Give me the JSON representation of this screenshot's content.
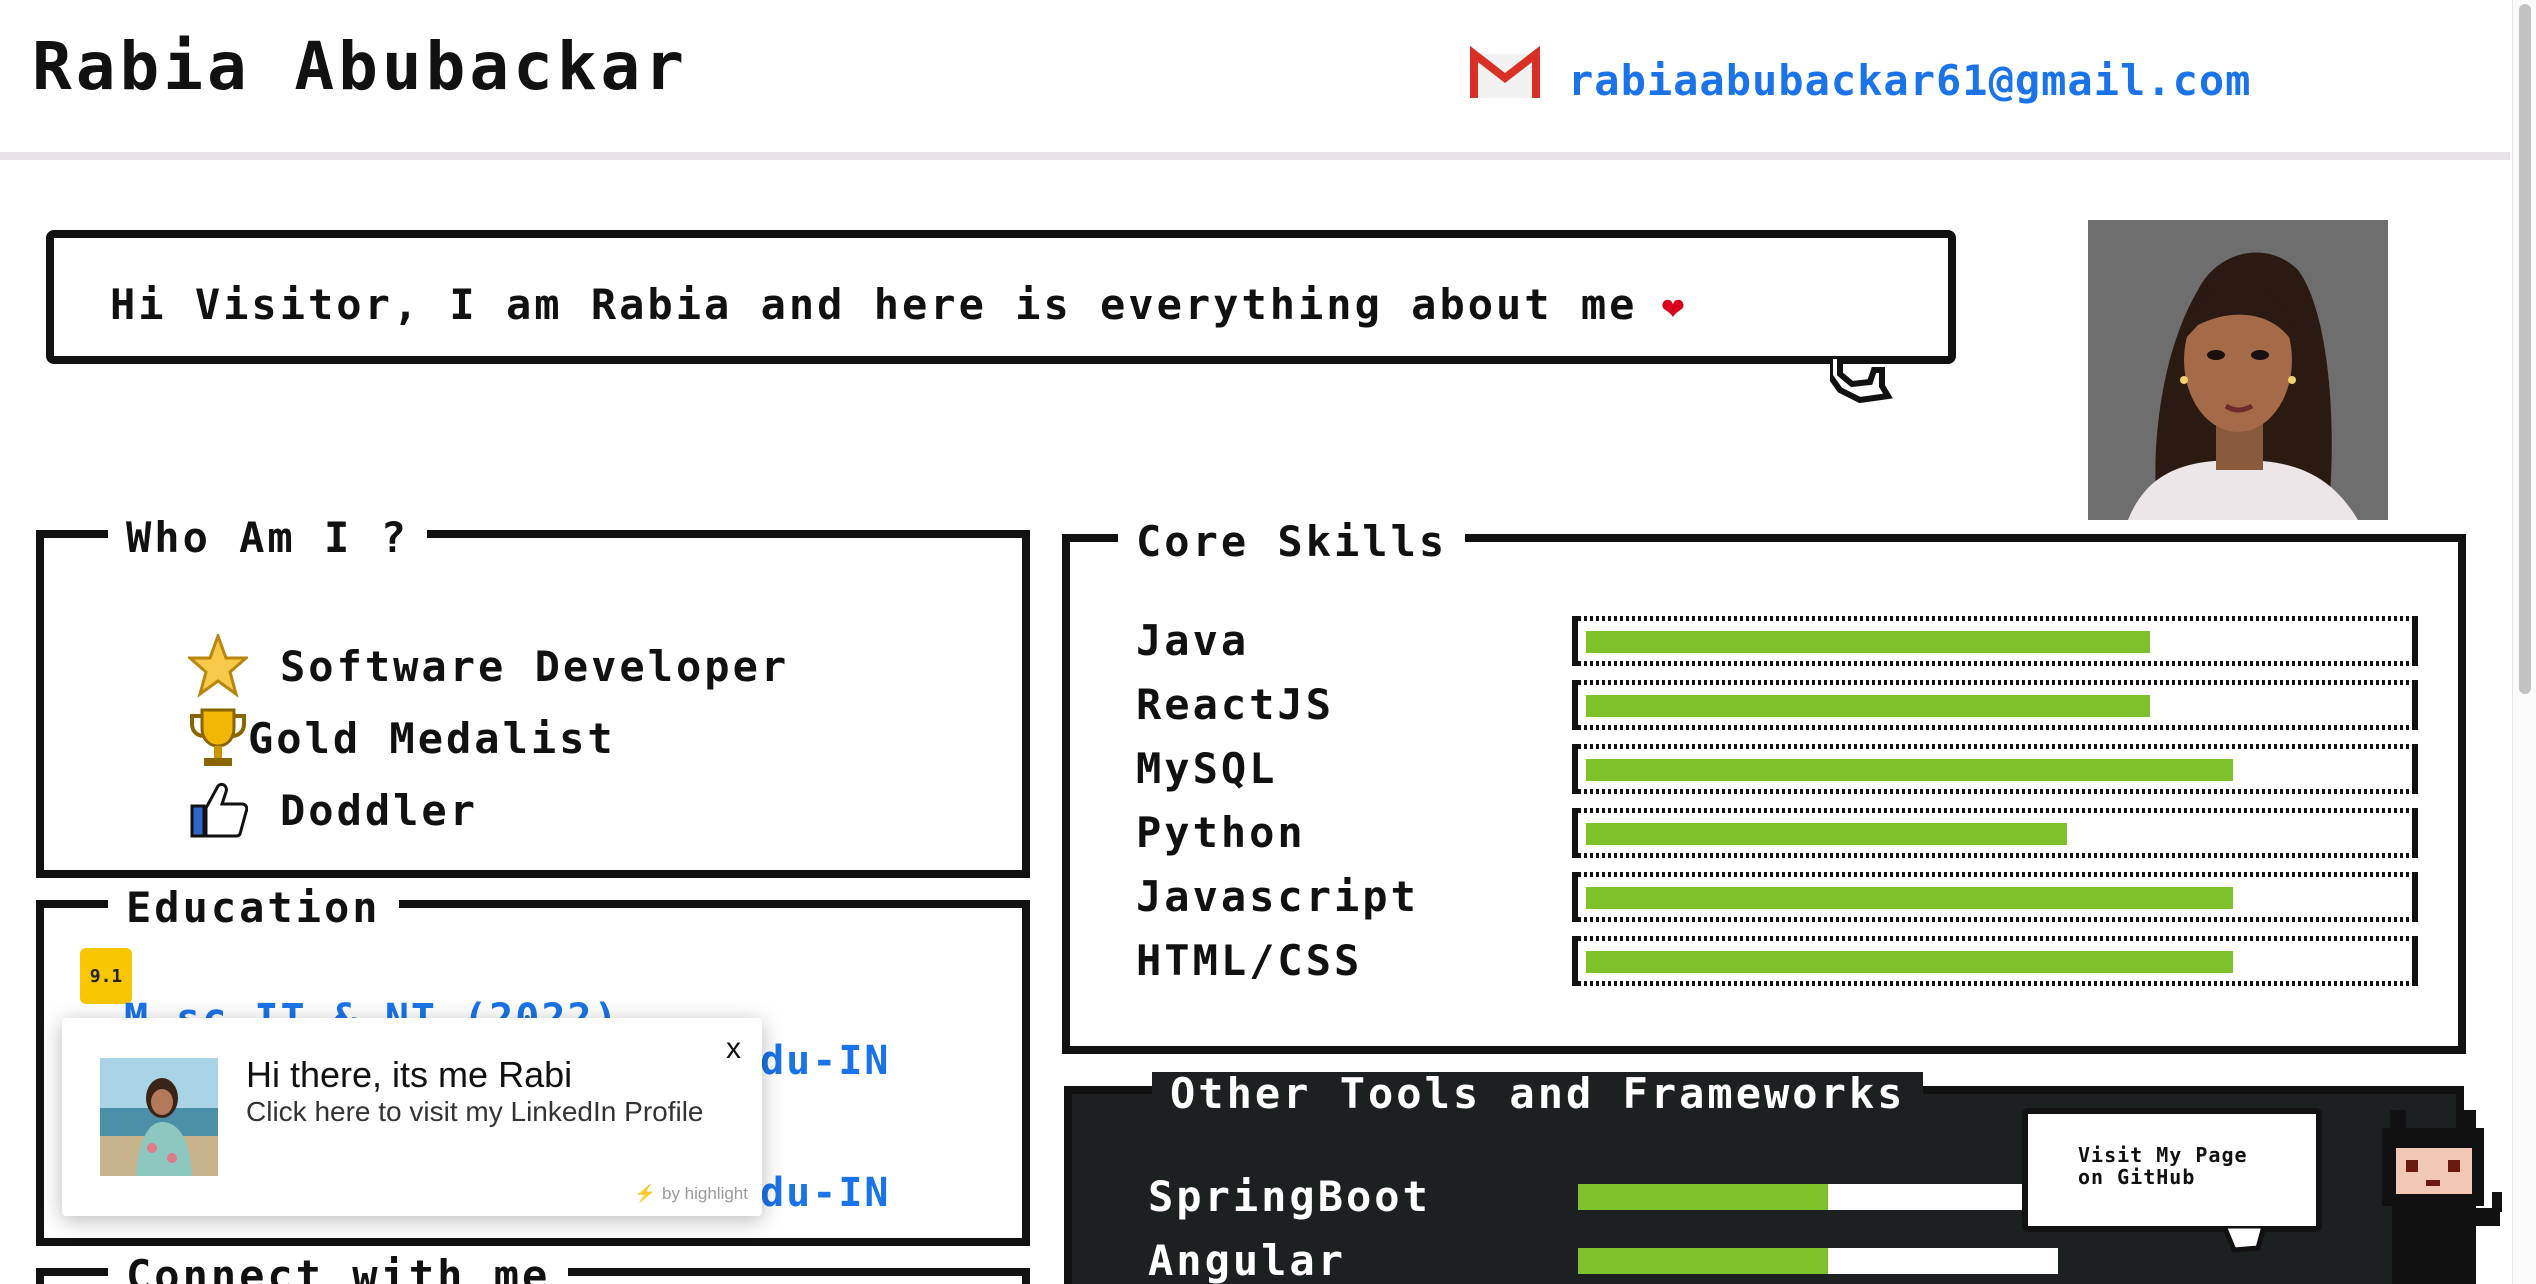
{
  "header": {
    "title": "Rabia Abubackar",
    "email": "rabiaabubackar61@gmail.com"
  },
  "intro": {
    "text": "Hi Visitor, I am Rabia and here is everything about me",
    "heart": "❤"
  },
  "who_am_i": {
    "title": "Who Am I ?",
    "items": [
      {
        "label": "Software Developer",
        "icon": "star-icon"
      },
      {
        "label": "Gold Medalist",
        "icon": "trophy-icon"
      },
      {
        "label": "Doddler",
        "icon": "thumbs-up-icon"
      }
    ]
  },
  "education": {
    "title": "Education",
    "badge": "9.1",
    "line1": "M.sc IT & NT (2022)",
    "line2_tail": "adu-IN",
    "line3_tail": "adu-IN"
  },
  "connect": {
    "title": "Connect with me"
  },
  "skills": {
    "title": "Core Skills",
    "items": [
      {
        "name": "Java",
        "level": 0.68
      },
      {
        "name": "ReactJS",
        "level": 0.68
      },
      {
        "name": "MySQL",
        "level": 0.78
      },
      {
        "name": "Python",
        "level": 0.58
      },
      {
        "name": "Javascript",
        "level": 0.78
      },
      {
        "name": "HTML/CSS",
        "level": 0.78
      }
    ]
  },
  "tools": {
    "title": "Other Tools and Frameworks",
    "items": [
      {
        "name": "SpringBoot",
        "level": 0.52
      },
      {
        "name": "Angular",
        "level": 0.52
      }
    ]
  },
  "github": {
    "line1": "Visit My Page",
    "line2": "on GitHub"
  },
  "popup": {
    "title": "Hi there, its me Rabi",
    "subtitle": "Click here to visit my LinkedIn Profile",
    "close": "x",
    "credit": "by highlight"
  },
  "colors": {
    "link": "#1a73e8",
    "skill_fill": "#7fc12a",
    "tools_bg": "#1d2021"
  }
}
